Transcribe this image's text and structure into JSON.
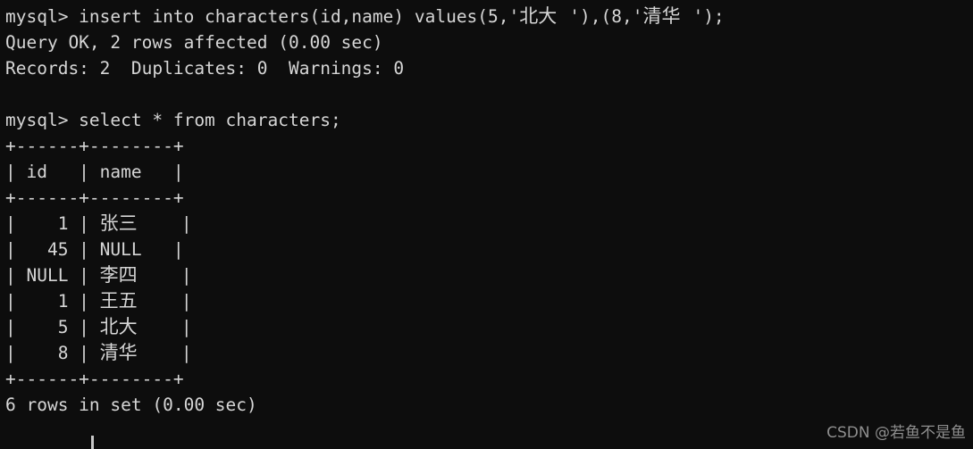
{
  "terminal": {
    "background_color": "#0d0d0d",
    "foreground_color": "#d6d6d6",
    "prompt": "mysql> ",
    "lines": {
      "insert_command": "mysql> insert into characters(id,name) values(5,'北大'),(8,'清华');",
      "insert_command_prefix": "mysql> insert into characters(id,name) values(5,'",
      "insert_literal_1": "北大",
      "insert_command_mid": "'),(8,'",
      "insert_literal_2": "清华",
      "insert_command_suffix": "');",
      "query_ok": "Query OK, 2 rows affected (0.00 sec)",
      "records": "Records: 2  Duplicates: 0  Warnings: 0",
      "blank": "",
      "select_command": "mysql> select * from characters;",
      "rows_in_set": "6 rows in set (0.00 sec)"
    },
    "result_table": {
      "separator": "+------+--------+",
      "header_row": "| id   | name   |",
      "columns": [
        "id",
        "name"
      ],
      "rows": [
        {
          "id": "1",
          "id_cell": "|    1 | ",
          "name": "张三",
          "name_is_cjk": true,
          "tail": "   |"
        },
        {
          "id": "45",
          "id_cell": "|   45 | ",
          "name": "NULL",
          "name_is_cjk": false,
          "tail": "   |"
        },
        {
          "id": "NULL",
          "id_cell": "| NULL | ",
          "name": "李四",
          "name_is_cjk": true,
          "tail": "   |"
        },
        {
          "id": "1",
          "id_cell": "|    1 | ",
          "name": "王五",
          "name_is_cjk": true,
          "tail": "   |"
        },
        {
          "id": "5",
          "id_cell": "|    5 | ",
          "name": "北大",
          "name_is_cjk": true,
          "tail": "   |"
        },
        {
          "id": "8",
          "id_cell": "|    8 | ",
          "name": "清华",
          "name_is_cjk": true,
          "tail": "   |"
        }
      ]
    },
    "cursor": {
      "visible": true,
      "shape": "bar"
    }
  },
  "watermark": {
    "text": "CSDN @若鱼不是鱼",
    "color": "#8e8e8e"
  }
}
